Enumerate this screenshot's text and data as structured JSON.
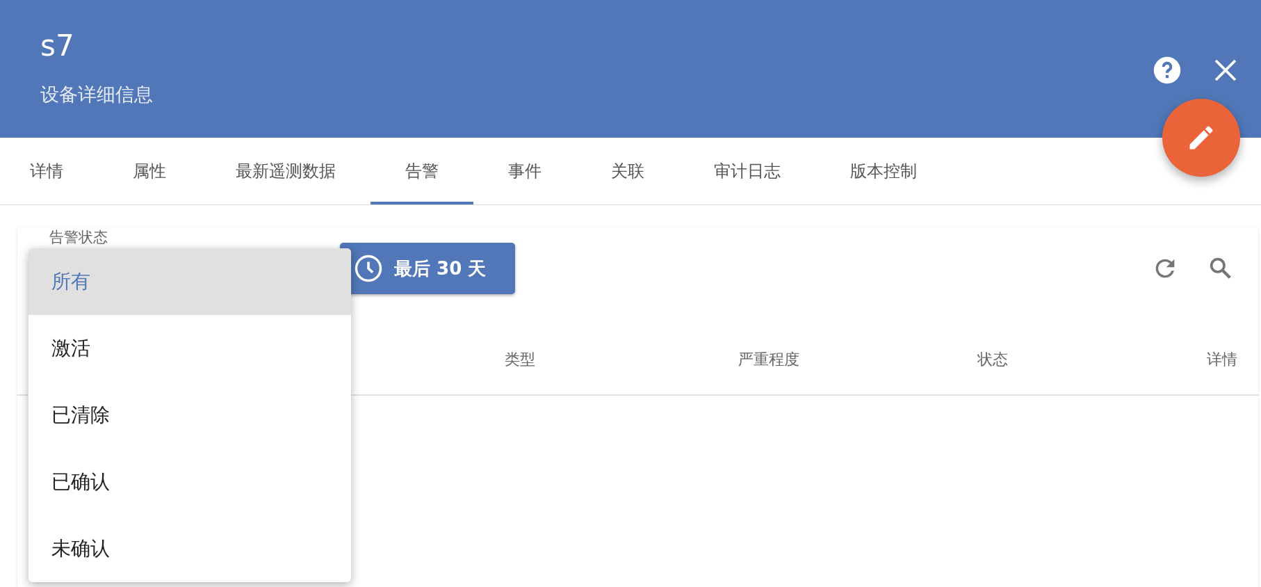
{
  "header": {
    "title": "s7",
    "subtitle": "设备详细信息"
  },
  "tabs": [
    {
      "label": "详情",
      "selected": false
    },
    {
      "label": "属性",
      "selected": false
    },
    {
      "label": "最新遥测数据",
      "selected": false
    },
    {
      "label": "告警",
      "selected": true
    },
    {
      "label": "事件",
      "selected": false
    },
    {
      "label": "关联",
      "selected": false
    },
    {
      "label": "审计日志",
      "selected": false
    },
    {
      "label": "版本控制",
      "selected": false
    }
  ],
  "filter": {
    "label": "告警状态",
    "options": [
      {
        "label": "所有",
        "selected": true
      },
      {
        "label": "激活",
        "selected": false
      },
      {
        "label": "已清除",
        "selected": false
      },
      {
        "label": "已确认",
        "selected": false
      },
      {
        "label": "未确认",
        "selected": false
      }
    ]
  },
  "time_button": {
    "label": "最后 30 天"
  },
  "table": {
    "columns": [
      "类型",
      "严重程度",
      "状态",
      "详情"
    ]
  }
}
